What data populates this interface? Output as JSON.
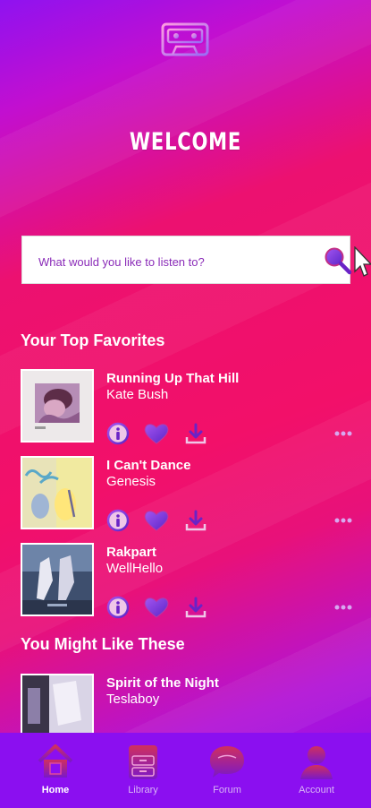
{
  "header": {
    "logo_icon": "cassette-tape-icon",
    "welcome": "WELCOME"
  },
  "search": {
    "placeholder": "What would you like to listen to?",
    "icon": "search-magnifier-icon"
  },
  "top_favorites": {
    "title": "Your Top Favorites",
    "items": [
      {
        "title": "Running Up That Hill",
        "artist": "Kate Bush"
      },
      {
        "title": "I Can't Dance",
        "artist": "Genesis"
      },
      {
        "title": "Rakpart",
        "artist": "WellHello"
      }
    ]
  },
  "recommended": {
    "title": "You Might Like These",
    "items": [
      {
        "title": "Spirit of the Night",
        "artist": "Teslaboy"
      }
    ]
  },
  "track_actions": [
    "info-icon",
    "heart-icon",
    "download-icon",
    "more-dots-icon"
  ],
  "bottom_nav": {
    "items": [
      {
        "label": "Home",
        "icon": "home-icon",
        "active": true
      },
      {
        "label": "Library",
        "icon": "library-icon",
        "active": false
      },
      {
        "label": "Forum",
        "icon": "chat-bubble-icon",
        "active": false
      },
      {
        "label": "Account",
        "icon": "user-icon",
        "active": false
      }
    ]
  },
  "colors": {
    "accent_purple": "#8b0ff0",
    "accent_pink": "#f21069",
    "icon_purple": "#7d2fd0"
  }
}
